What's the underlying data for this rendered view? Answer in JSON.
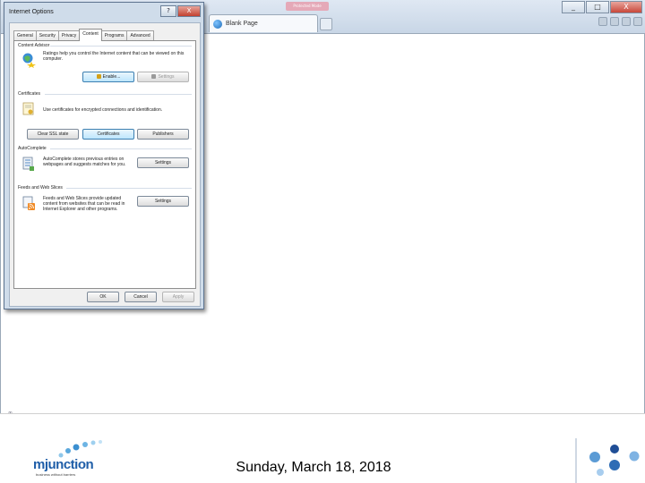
{
  "browser": {
    "tab_label": "Blank Page",
    "top_badge": "Protected Mode",
    "window_buttons": [
      "_",
      "□",
      "X"
    ],
    "status_glyph": "∞"
  },
  "dialog": {
    "title": "Internet Options",
    "help_btn": "?",
    "close_btn": "X",
    "tabs": [
      "General",
      "Security",
      "Privacy",
      "Content",
      "Programs",
      "Advanced"
    ],
    "active_tab": "Content",
    "content_advisor": {
      "label": "Content Advisor",
      "desc": "Ratings help you control the Internet content that can be viewed on this computer.",
      "enable_label": "Enable...",
      "settings_label": "Settings"
    },
    "certificates": {
      "label": "Certificates",
      "desc": "Use certificates for encrypted connections and identification.",
      "clear_ssl_label": "Clear SSL state",
      "certificates_label": "Certificates",
      "publishers_label": "Publishers"
    },
    "autocomplete": {
      "label": "AutoComplete",
      "desc": "AutoComplete stores previous entries on webpages and suggests matches for you.",
      "settings_label": "Settings"
    },
    "feeds": {
      "label": "Feeds and Web Slices",
      "desc": "Feeds and Web Slices provide updated content from websites that can be read in Internet Explorer and other programs.",
      "settings_label": "Settings"
    },
    "footer": {
      "ok_label": "OK",
      "cancel_label": "Cancel",
      "apply_label": "Apply"
    }
  },
  "footer": {
    "logo_text": "mjunction",
    "logo_tagline": "business without barriers",
    "date": "Sunday, March 18, 2018"
  }
}
